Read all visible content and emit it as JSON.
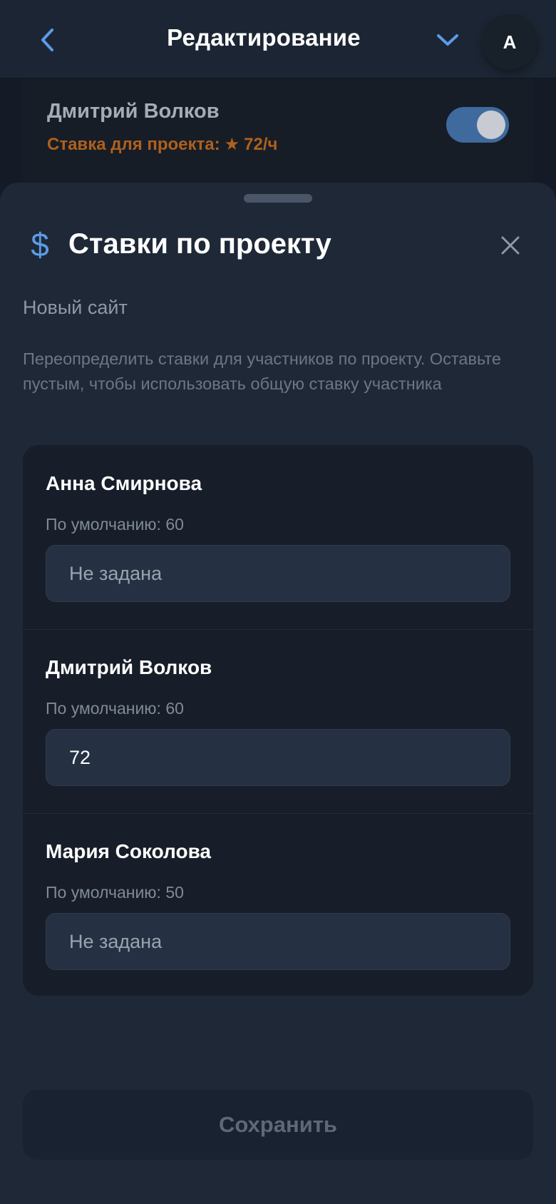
{
  "header": {
    "title": "Редактирование",
    "avatar_initial": "A",
    "back_icon": "chevron-left-icon",
    "expand_icon": "chevron-down-icon"
  },
  "background_member": {
    "name": "Дмитрий Волков",
    "rate_label": "Ставка для проекта:",
    "rate_value": "72/ч",
    "rate_icon": "star-icon",
    "toggle_on": true
  },
  "sheet": {
    "icon": "dollar-icon",
    "title": "Ставки по проекту",
    "project_name": "Новый сайт",
    "description": "Переопределить ставки для участников по проекту. Оставьте пустым, чтобы использовать общую ставку участника",
    "members": [
      {
        "name": "Анна Смирнова",
        "default_label": "По умолчанию: 60",
        "value": "",
        "placeholder": "Не задана"
      },
      {
        "name": "Дмитрий Волков",
        "default_label": "По умолчанию: 60",
        "value": "72",
        "placeholder": "Не задана"
      },
      {
        "name": "Мария Соколова",
        "default_label": "По умолчанию: 50",
        "value": "",
        "placeholder": "Не задана"
      }
    ],
    "save_label": "Сохранить"
  },
  "colors": {
    "accent": "#5b9be6",
    "rate_highlight": "#b0601c",
    "sheet_background": "#1f2837"
  }
}
